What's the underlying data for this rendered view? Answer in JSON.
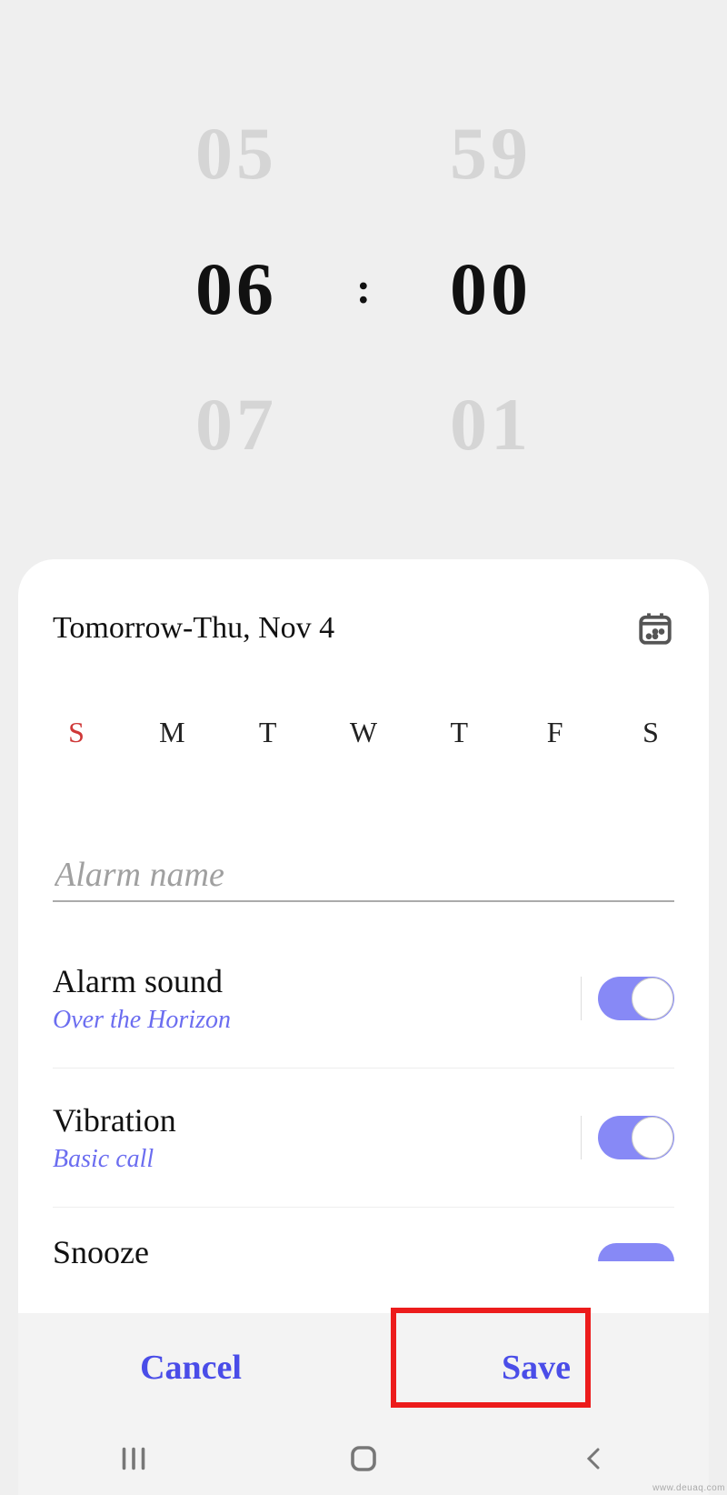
{
  "time_picker": {
    "hour_prev": "05",
    "hour": "06",
    "hour_next": "07",
    "min_prev": "59",
    "min": "00",
    "min_next": "01",
    "sep": ":"
  },
  "date": {
    "label": "Tomorrow-Thu, Nov 4"
  },
  "days": [
    "S",
    "M",
    "T",
    "W",
    "T",
    "F",
    "S"
  ],
  "alarm_name": {
    "placeholder": "Alarm name",
    "value": ""
  },
  "settings": {
    "sound": {
      "title": "Alarm sound",
      "subtitle": "Over the Horizon",
      "enabled": true
    },
    "vibration": {
      "title": "Vibration",
      "subtitle": "Basic call",
      "enabled": true
    },
    "snooze": {
      "title": "Snooze",
      "enabled": true
    }
  },
  "buttons": {
    "cancel": "Cancel",
    "save": "Save"
  },
  "highlight": "save",
  "watermark": "www.deuaq.com"
}
